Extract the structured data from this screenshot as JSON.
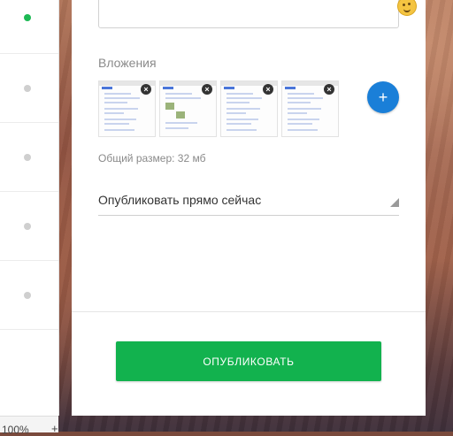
{
  "attachments": {
    "label": "Вложения",
    "thumbnails": [
      {
        "name": "screenshot-1",
        "remove_glyph": "×"
      },
      {
        "name": "screenshot-2",
        "remove_glyph": "×"
      },
      {
        "name": "screenshot-3",
        "remove_glyph": "×"
      },
      {
        "name": "screenshot-4",
        "remove_glyph": "×"
      }
    ],
    "add_glyph": "+",
    "total_size": "Общий размер: 32 мб"
  },
  "publish": {
    "schedule_value": "Опубликовать прямо сейчас",
    "button_label": "ОПУБЛИКОВАТЬ"
  },
  "status": {
    "zoom": "100%",
    "zoom_plus": "+"
  },
  "icons": {
    "emoji": "wink-emoji-icon",
    "remove": "close-circle-icon",
    "add": "plus-icon",
    "dropdown": "triangle-dropdown-icon"
  },
  "colors": {
    "accent_green": "#12b24e",
    "accent_blue": "#1a7fd8",
    "active_dot": "#1db954"
  }
}
